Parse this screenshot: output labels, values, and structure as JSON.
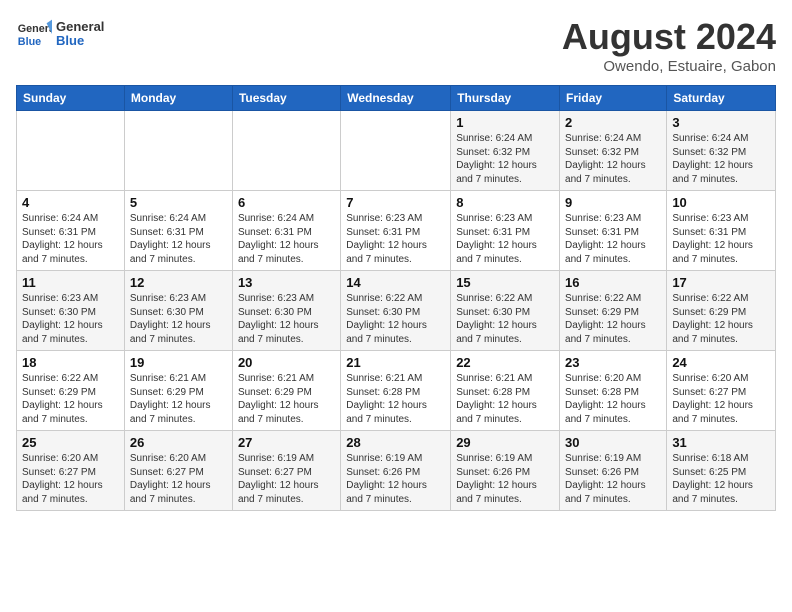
{
  "logo": {
    "line1": "General",
    "line2": "Blue"
  },
  "title": "August 2024",
  "subtitle": "Owendo, Estuaire, Gabon",
  "days_of_week": [
    "Sunday",
    "Monday",
    "Tuesday",
    "Wednesday",
    "Thursday",
    "Friday",
    "Saturday"
  ],
  "weeks": [
    [
      {
        "day": "",
        "info": ""
      },
      {
        "day": "",
        "info": ""
      },
      {
        "day": "",
        "info": ""
      },
      {
        "day": "",
        "info": ""
      },
      {
        "day": "1",
        "info": "Sunrise: 6:24 AM\nSunset: 6:32 PM\nDaylight: 12 hours\nand 7 minutes."
      },
      {
        "day": "2",
        "info": "Sunrise: 6:24 AM\nSunset: 6:32 PM\nDaylight: 12 hours\nand 7 minutes."
      },
      {
        "day": "3",
        "info": "Sunrise: 6:24 AM\nSunset: 6:32 PM\nDaylight: 12 hours\nand 7 minutes."
      }
    ],
    [
      {
        "day": "4",
        "info": "Sunrise: 6:24 AM\nSunset: 6:31 PM\nDaylight: 12 hours\nand 7 minutes."
      },
      {
        "day": "5",
        "info": "Sunrise: 6:24 AM\nSunset: 6:31 PM\nDaylight: 12 hours\nand 7 minutes."
      },
      {
        "day": "6",
        "info": "Sunrise: 6:24 AM\nSunset: 6:31 PM\nDaylight: 12 hours\nand 7 minutes."
      },
      {
        "day": "7",
        "info": "Sunrise: 6:23 AM\nSunset: 6:31 PM\nDaylight: 12 hours\nand 7 minutes."
      },
      {
        "day": "8",
        "info": "Sunrise: 6:23 AM\nSunset: 6:31 PM\nDaylight: 12 hours\nand 7 minutes."
      },
      {
        "day": "9",
        "info": "Sunrise: 6:23 AM\nSunset: 6:31 PM\nDaylight: 12 hours\nand 7 minutes."
      },
      {
        "day": "10",
        "info": "Sunrise: 6:23 AM\nSunset: 6:31 PM\nDaylight: 12 hours\nand 7 minutes."
      }
    ],
    [
      {
        "day": "11",
        "info": "Sunrise: 6:23 AM\nSunset: 6:30 PM\nDaylight: 12 hours\nand 7 minutes."
      },
      {
        "day": "12",
        "info": "Sunrise: 6:23 AM\nSunset: 6:30 PM\nDaylight: 12 hours\nand 7 minutes."
      },
      {
        "day": "13",
        "info": "Sunrise: 6:23 AM\nSunset: 6:30 PM\nDaylight: 12 hours\nand 7 minutes."
      },
      {
        "day": "14",
        "info": "Sunrise: 6:22 AM\nSunset: 6:30 PM\nDaylight: 12 hours\nand 7 minutes."
      },
      {
        "day": "15",
        "info": "Sunrise: 6:22 AM\nSunset: 6:30 PM\nDaylight: 12 hours\nand 7 minutes."
      },
      {
        "day": "16",
        "info": "Sunrise: 6:22 AM\nSunset: 6:29 PM\nDaylight: 12 hours\nand 7 minutes."
      },
      {
        "day": "17",
        "info": "Sunrise: 6:22 AM\nSunset: 6:29 PM\nDaylight: 12 hours\nand 7 minutes."
      }
    ],
    [
      {
        "day": "18",
        "info": "Sunrise: 6:22 AM\nSunset: 6:29 PM\nDaylight: 12 hours\nand 7 minutes."
      },
      {
        "day": "19",
        "info": "Sunrise: 6:21 AM\nSunset: 6:29 PM\nDaylight: 12 hours\nand 7 minutes."
      },
      {
        "day": "20",
        "info": "Sunrise: 6:21 AM\nSunset: 6:29 PM\nDaylight: 12 hours\nand 7 minutes."
      },
      {
        "day": "21",
        "info": "Sunrise: 6:21 AM\nSunset: 6:28 PM\nDaylight: 12 hours\nand 7 minutes."
      },
      {
        "day": "22",
        "info": "Sunrise: 6:21 AM\nSunset: 6:28 PM\nDaylight: 12 hours\nand 7 minutes."
      },
      {
        "day": "23",
        "info": "Sunrise: 6:20 AM\nSunset: 6:28 PM\nDaylight: 12 hours\nand 7 minutes."
      },
      {
        "day": "24",
        "info": "Sunrise: 6:20 AM\nSunset: 6:27 PM\nDaylight: 12 hours\nand 7 minutes."
      }
    ],
    [
      {
        "day": "25",
        "info": "Sunrise: 6:20 AM\nSunset: 6:27 PM\nDaylight: 12 hours\nand 7 minutes."
      },
      {
        "day": "26",
        "info": "Sunrise: 6:20 AM\nSunset: 6:27 PM\nDaylight: 12 hours\nand 7 minutes."
      },
      {
        "day": "27",
        "info": "Sunrise: 6:19 AM\nSunset: 6:27 PM\nDaylight: 12 hours\nand 7 minutes."
      },
      {
        "day": "28",
        "info": "Sunrise: 6:19 AM\nSunset: 6:26 PM\nDaylight: 12 hours\nand 7 minutes."
      },
      {
        "day": "29",
        "info": "Sunrise: 6:19 AM\nSunset: 6:26 PM\nDaylight: 12 hours\nand 7 minutes."
      },
      {
        "day": "30",
        "info": "Sunrise: 6:19 AM\nSunset: 6:26 PM\nDaylight: 12 hours\nand 7 minutes."
      },
      {
        "day": "31",
        "info": "Sunrise: 6:18 AM\nSunset: 6:25 PM\nDaylight: 12 hours\nand 7 minutes."
      }
    ]
  ]
}
